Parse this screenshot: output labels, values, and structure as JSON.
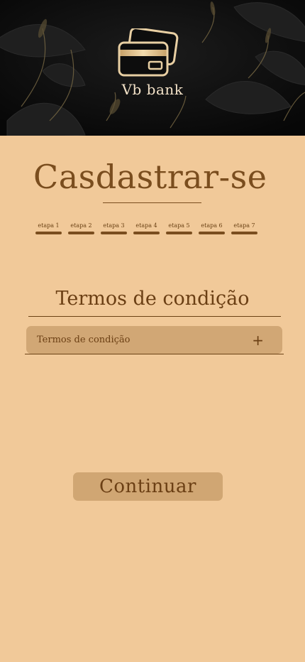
{
  "header": {
    "brand": "Vb bank",
    "logo_icon": "credit-cards-icon"
  },
  "page": {
    "title": "Casdastrar-se"
  },
  "steps": [
    {
      "label": "etapa 1"
    },
    {
      "label": "etapa 2"
    },
    {
      "label": "etapa 3"
    },
    {
      "label": "etapa 4"
    },
    {
      "label": "etapa 5"
    },
    {
      "label": "etapa 6"
    },
    {
      "label": "etapa 7"
    }
  ],
  "terms": {
    "section_title": "Termos de condição",
    "accordion_label": "Termos de condição",
    "expand_icon": "plus-icon"
  },
  "actions": {
    "continue_label": "Continuar"
  },
  "colors": {
    "background": "#f1c999",
    "accent": "#7a4d1e",
    "panel": "#d1a775",
    "header_bg": "#0d0d0d"
  }
}
